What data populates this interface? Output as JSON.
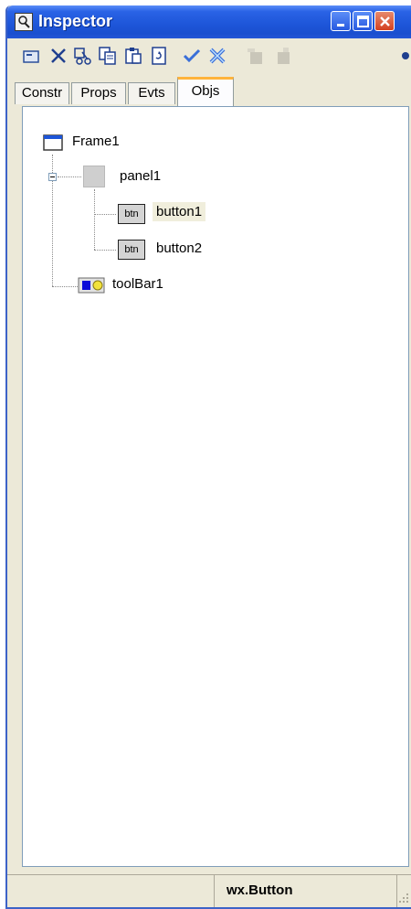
{
  "window": {
    "title": "Inspector",
    "title_icon": "inspector-icon"
  },
  "title_buttons": [
    "minimize-icon",
    "maximize-icon",
    "close-icon"
  ],
  "toolbar": {
    "tools": [
      "open-icon",
      "delete-icon",
      "cut-icon",
      "copy-icon",
      "paste-icon",
      "refresh-icon",
      "check-icon",
      "cancel-icon",
      "tool-disabled-icon",
      "tool-disabled-icon",
      "next-icon"
    ]
  },
  "tabs": [
    {
      "label": "Constr",
      "active": false
    },
    {
      "label": "Props",
      "active": false
    },
    {
      "label": "Evts",
      "active": false
    },
    {
      "label": "Objs",
      "active": true
    }
  ],
  "tree": {
    "nodes": [
      {
        "label": "Frame1",
        "icon": "frame-icon"
      },
      {
        "label": "panel1",
        "icon": "panel-icon",
        "expanded": true
      },
      {
        "label": "button1",
        "icon": "btn-icon",
        "icon_text": "btn",
        "selected": true
      },
      {
        "label": "button2",
        "icon": "btn-icon",
        "icon_text": "btn"
      },
      {
        "label": "toolBar1",
        "icon": "toolbar-icon"
      }
    ]
  },
  "status": {
    "text": "wx.Button"
  },
  "colors": {
    "titlebar": "#1d55d8",
    "selection": "#f0eedc",
    "active_tab_accent": "#ffb43c"
  }
}
